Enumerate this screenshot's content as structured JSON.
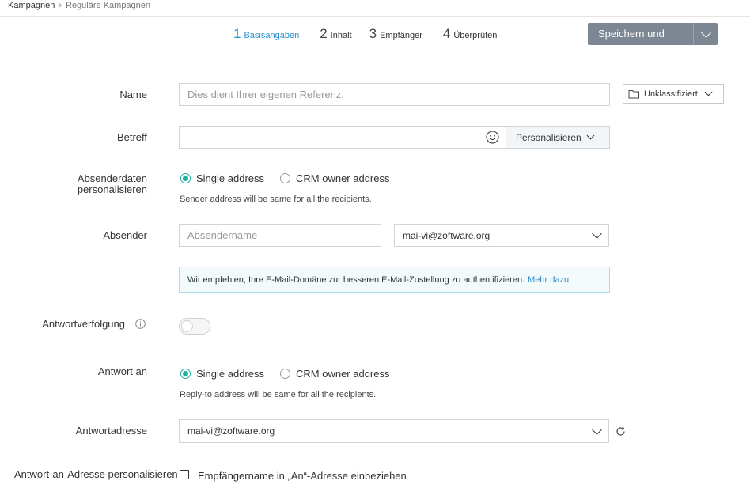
{
  "breadcrumb": {
    "parent": "Kampagnen",
    "separator": "›",
    "current": "Reguläre Kampagnen"
  },
  "steps": [
    {
      "num": "1",
      "label": "Basisangaben",
      "active": true
    },
    {
      "num": "2",
      "label": "Inhalt",
      "active": false
    },
    {
      "num": "3",
      "label": "Empfänger",
      "active": false
    },
    {
      "num": "4",
      "label": "Überprüfen",
      "active": false
    }
  ],
  "toolbar": {
    "save_label": "Speichern und beenden"
  },
  "form": {
    "name": {
      "label": "Name",
      "placeholder": "Dies dient Ihrer eigenen Referenz.",
      "category": "Unklassifiziert"
    },
    "subject": {
      "label": "Betreff",
      "value": "",
      "personalize": "Personalisieren"
    },
    "sender_personalize": {
      "label_line1": "Absenderdaten",
      "label_line2": "personalisieren",
      "options": [
        "Single address",
        "CRM owner address"
      ],
      "selected": "Single address",
      "hint": "Sender address will be same for all the recipients."
    },
    "sender": {
      "label": "Absender",
      "name_placeholder": "Absendername",
      "email": "mai-vi@zoftware.org"
    },
    "notice": {
      "text": "Wir empfehlen, Ihre E-Mail-Domäne zur besseren E-Mail-Zustellung zu authentifizieren.",
      "link": "Mehr dazu"
    },
    "reply_tracking": {
      "label": "Antwortverfolgung",
      "enabled": false
    },
    "reply_to": {
      "label": "Antwort an",
      "options": [
        "Single address",
        "CRM owner address"
      ],
      "selected": "Single address",
      "hint": "Reply-to address will be same for all the recipients."
    },
    "reply_address": {
      "label": "Antwortadresse",
      "value": "mai-vi@zoftware.org"
    },
    "reply_personalize": {
      "label": "Antwort-an-Adresse personalisieren",
      "checkbox_label": "Empfängername in „An“-Adresse einbeziehen",
      "checked": false
    }
  },
  "colors": {
    "accent": "#2c8fcd",
    "radio": "#1fb09e",
    "button": "#7c8793"
  }
}
